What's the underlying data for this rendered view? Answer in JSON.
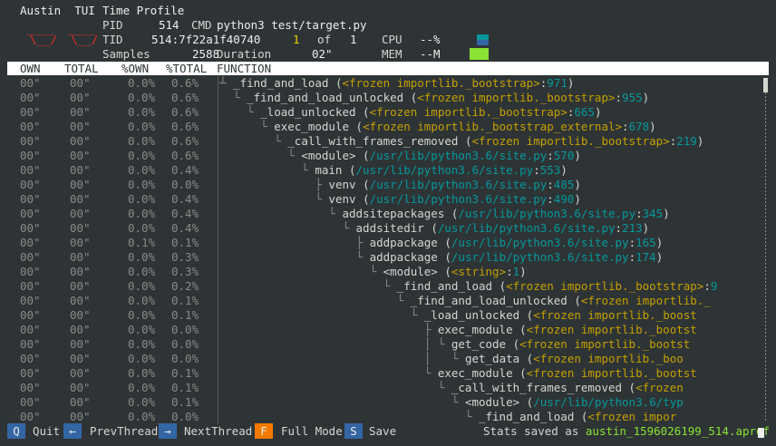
{
  "app": {
    "title_left": "Austin  TUI",
    "title_mode": "Time Profile",
    "logo_line1": " ____  ____",
    "logo_line2": "\\__/  \\__/"
  },
  "info": {
    "pid_label": "PID",
    "pid_value": "514",
    "cmd_label": "CMD",
    "cmd_value": "python3 test/target.py",
    "tid_label": "TID",
    "tid_value": "514:7f22a1f40740",
    "thread_index": "1",
    "of_label": "of",
    "thread_total": "1",
    "cpu_label": "CPU",
    "cpu_value": "--%",
    "samples_label": "Samples",
    "samples_value": "2588",
    "duration_label": "Duration",
    "duration_value": "02\"",
    "mem_label": "MEM",
    "mem_value": "--M",
    "cpu_bar_color": "#3465a4",
    "cpu_bar_color2": "#06989a",
    "mem_bar_color": "#8ae234"
  },
  "columns": {
    "own": "OWN",
    "total": "TOTAL",
    "pown": "%OWN",
    "ptotal": "%TOTAL",
    "function": "FUNCTION"
  },
  "rows": [
    {
      "own": "00\"",
      "total": "00\"",
      "pown": "0.0%",
      "ptotal": "0.6%",
      "prefix": "┴ ",
      "name": "_find_and_load",
      "loc_kind": "frz",
      "loc": "<frozen importlib._bootstrap>",
      "line": "971",
      "suffix": ")"
    },
    {
      "own": "00\"",
      "total": "00\"",
      "pown": "0.0%",
      "ptotal": "0.6%",
      "prefix": "  └ ",
      "name": "_find_and_load_unlocked",
      "loc_kind": "frz",
      "loc": "<frozen importlib._bootstrap>",
      "line": "955",
      "suffix": ")"
    },
    {
      "own": "00\"",
      "total": "00\"",
      "pown": "0.0%",
      "ptotal": "0.6%",
      "prefix": "    └ ",
      "name": "_load_unlocked",
      "loc_kind": "frz",
      "loc": "<frozen importlib._bootstrap>",
      "line": "665",
      "suffix": ")"
    },
    {
      "own": "00\"",
      "total": "00\"",
      "pown": "0.0%",
      "ptotal": "0.6%",
      "prefix": "      └ ",
      "name": "exec_module",
      "loc_kind": "frz",
      "loc": "<frozen importlib._bootstrap_external>",
      "line": "678",
      "suffix": ")"
    },
    {
      "own": "00\"",
      "total": "00\"",
      "pown": "0.0%",
      "ptotal": "0.6%",
      "prefix": "        └ ",
      "name": "_call_with_frames_removed",
      "loc_kind": "frz",
      "loc": "<frozen importlib._bootstrap>",
      "line": "219",
      "suffix": ")"
    },
    {
      "own": "00\"",
      "total": "00\"",
      "pown": "0.0%",
      "ptotal": "0.6%",
      "prefix": "          └ ",
      "name": "<module>",
      "loc_kind": "path",
      "loc": "/usr/lib/python3.6/site.py",
      "line": "570",
      "suffix": ")"
    },
    {
      "own": "00\"",
      "total": "00\"",
      "pown": "0.0%",
      "ptotal": "0.4%",
      "prefix": "            └ ",
      "name": "main",
      "loc_kind": "path",
      "loc": "/usr/lib/python3.6/site.py",
      "line": "553",
      "suffix": ")"
    },
    {
      "own": "00\"",
      "total": "00\"",
      "pown": "0.0%",
      "ptotal": "0.0%",
      "prefix": "              ├ ",
      "name": "venv",
      "loc_kind": "path",
      "loc": "/usr/lib/python3.6/site.py",
      "line": "485",
      "suffix": ")"
    },
    {
      "own": "00\"",
      "total": "00\"",
      "pown": "0.0%",
      "ptotal": "0.4%",
      "prefix": "              └ ",
      "name": "venv",
      "loc_kind": "path",
      "loc": "/usr/lib/python3.6/site.py",
      "line": "490",
      "suffix": ")"
    },
    {
      "own": "00\"",
      "total": "00\"",
      "pown": "0.0%",
      "ptotal": "0.4%",
      "prefix": "                └ ",
      "name": "addsitepackages",
      "loc_kind": "path",
      "loc": "/usr/lib/python3.6/site.py",
      "line": "345",
      "suffix": ")"
    },
    {
      "own": "00\"",
      "total": "00\"",
      "pown": "0.0%",
      "ptotal": "0.4%",
      "prefix": "                  └ ",
      "name": "addsitedir",
      "loc_kind": "path",
      "loc": "/usr/lib/python3.6/site.py",
      "line": "213",
      "suffix": ")"
    },
    {
      "own": "00\"",
      "total": "00\"",
      "pown": "0.1%",
      "ptotal": "0.1%",
      "prefix": "                    ├ ",
      "name": "addpackage",
      "loc_kind": "path",
      "loc": "/usr/lib/python3.6/site.py",
      "line": "165",
      "suffix": ")"
    },
    {
      "own": "00\"",
      "total": "00\"",
      "pown": "0.0%",
      "ptotal": "0.3%",
      "prefix": "                    └ ",
      "name": "addpackage",
      "loc_kind": "path",
      "loc": "/usr/lib/python3.6/site.py",
      "line": "174",
      "suffix": ")"
    },
    {
      "own": "00\"",
      "total": "00\"",
      "pown": "0.0%",
      "ptotal": "0.3%",
      "prefix": "                      └ ",
      "name": "<module>",
      "loc_kind": "frz",
      "loc": "<string>",
      "line": "1",
      "suffix": ")"
    },
    {
      "own": "00\"",
      "total": "00\"",
      "pown": "0.0%",
      "ptotal": "0.2%",
      "prefix": "                        └ ",
      "name": "_find_and_load",
      "loc_kind": "frz",
      "loc": "<frozen importlib._bootstrap>",
      "line": "9",
      "suffix": ""
    },
    {
      "own": "00\"",
      "total": "00\"",
      "pown": "0.0%",
      "ptotal": "0.1%",
      "prefix": "                          └ ",
      "name": "_find_and_load_unlocked",
      "loc_kind": "frz",
      "loc": "<frozen importlib._",
      "line": "",
      "suffix": ""
    },
    {
      "own": "00\"",
      "total": "00\"",
      "pown": "0.0%",
      "ptotal": "0.1%",
      "prefix": "                            └ ",
      "name": "_load_unlocked",
      "loc_kind": "frz",
      "loc": "<frozen importlib._boost",
      "line": "",
      "suffix": ""
    },
    {
      "own": "00\"",
      "total": "00\"",
      "pown": "0.0%",
      "ptotal": "0.0%",
      "prefix": "                              ├ ",
      "name": "exec_module",
      "loc_kind": "frz",
      "loc": "<frozen importlib._bootst",
      "line": "",
      "suffix": ""
    },
    {
      "own": "00\"",
      "total": "00\"",
      "pown": "0.0%",
      "ptotal": "0.0%",
      "prefix": "                              │ └ ",
      "name": "get_code",
      "loc_kind": "frz",
      "loc": "<frozen importlib._bootst",
      "line": "",
      "suffix": ""
    },
    {
      "own": "00\"",
      "total": "00\"",
      "pown": "0.0%",
      "ptotal": "0.0%",
      "prefix": "                              │   └ ",
      "name": "get_data",
      "loc_kind": "frz",
      "loc": "<frozen importlib._boo",
      "line": "",
      "suffix": ""
    },
    {
      "own": "00\"",
      "total": "00\"",
      "pown": "0.0%",
      "ptotal": "0.1%",
      "prefix": "                              └ ",
      "name": "exec_module",
      "loc_kind": "frz",
      "loc": "<frozen importlib._bootst",
      "line": "",
      "suffix": ""
    },
    {
      "own": "00\"",
      "total": "00\"",
      "pown": "0.0%",
      "ptotal": "0.1%",
      "prefix": "                                └ ",
      "name": "_call_with_frames_removed",
      "loc_kind": "frz",
      "loc": "<frozen",
      "line": "",
      "suffix": ""
    },
    {
      "own": "00\"",
      "total": "00\"",
      "pown": "0.0%",
      "ptotal": "0.1%",
      "prefix": "                                  └ ",
      "name": "<module>",
      "loc_kind": "path",
      "loc": "/usr/lib/python3.6/typ",
      "line": "",
      "suffix": ""
    },
    {
      "own": "00\"",
      "total": "00\"",
      "pown": "0.0%",
      "ptotal": "0.0%",
      "prefix": "                                    └ ",
      "name": "_find_and_load",
      "loc_kind": "frz",
      "loc": "<frozen impor",
      "line": "",
      "suffix": ""
    }
  ],
  "footer": {
    "keys": [
      {
        "key": "Q",
        "label": "Quit",
        "color": "#3465a4"
      },
      {
        "key": "←",
        "label": "PrevThread",
        "color": "#3465a4"
      },
      {
        "key": "→",
        "label": "NextThread",
        "color": "#3465a4"
      },
      {
        "key": "F",
        "label": "Full Mode",
        "color": "#f57900"
      },
      {
        "key": "S",
        "label": "Save",
        "color": "#3465a4"
      }
    ],
    "stats_prefix": "Stats saved as ",
    "stats_file": "austin_1596026199_514.aprof"
  }
}
